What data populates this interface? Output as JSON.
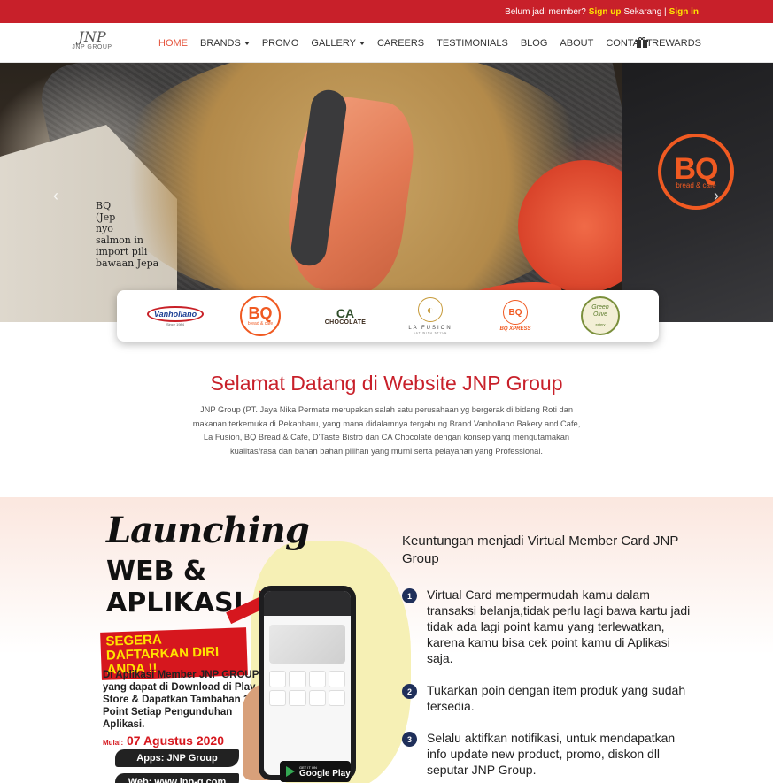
{
  "topbar": {
    "prefix": "Belum jadi member?",
    "signup": "Sign up",
    "middle": "Sekarang |",
    "signin": "Sign in"
  },
  "nav": {
    "logo_mark": "JNP",
    "logo_text": "JNP GROUP",
    "items": [
      "HOME",
      "BRANDS",
      "PROMO",
      "GALLERY",
      "CAREERS",
      "TESTIMONIALS",
      "BLOG",
      "ABOUT",
      "CONTACT"
    ],
    "rewards": "REWARDS"
  },
  "hero": {
    "newspaper_text": [
      "BQ",
      "(Jep",
      "nyo",
      "salmon in",
      "import pili",
      "bawaan Jepa"
    ],
    "bq_logo": "BQ",
    "bq_logo_sub": "bread & cafe",
    "prev_icon": "‹",
    "next_icon": "›"
  },
  "brands": {
    "vanhollano": "Vanhollano",
    "vanhollano_sub": "Since 1984",
    "bq": "BQ",
    "bq_sub": "bread & cafe",
    "ca_mark": "CA",
    "ca_text": "CHOCOLATE",
    "lafusion_mark": "◐",
    "lafusion": "LA FUSION",
    "lafusion_sub": "EAT WITH STYLE",
    "bqx_mark": "BQ",
    "bqx": "BQ XPRESS",
    "greenolive_1": "Green",
    "greenolive_2": "Olive",
    "greenolive_sub": "eatery"
  },
  "welcome": {
    "title": "Selamat Datang di Website JNP Group",
    "body": "JNP Group (PT. Jaya Nika Permata merupakan salah satu perusahaan yg bergerak di bidang Roti  dan makanan terkemuka di Pekanbaru, yang mana didalamnya tergabung Brand Vanhollano Bakery and Cafe, La Fusion, BQ Bread & Cafe, D'Taste Bistro dan CA Chocolate dengan konsep yang mengutamakan kualitas/rasa dan bahan bahan pilihan yang murni serta pelayanan yang Professional."
  },
  "poster": {
    "launching": "Launching",
    "web": "WEB &",
    "aplikasi": "APLIKASI",
    "banner": "SEGERA DAFTARKAN DIRI ANDA !!",
    "desc": "Di Aplikasi Member JNP GROUP yang dapat di Download di Play Store & Dapatkan Tambahan 10 Point Setiap Pengunduhan Aplikasi.",
    "mulai": "Mulai:",
    "date": "07 Agustus 2020",
    "apps": "Apps: JNP Group",
    "web_url": "Web: www.jnp-g.com",
    "getiton": "GET IT ON",
    "googleplay": "Google Play"
  },
  "benefits": {
    "title": "Keuntungan menjadi Virtual Member Card JNP Group",
    "items": [
      {
        "num": "1",
        "text": "Virtual Card mempermudah kamu dalam transaksi belanja,tidak perlu lagi bawa kartu jadi tidak ada lagi point kamu yang terlewatkan, karena kamu bisa cek point kamu di Aplikasi saja."
      },
      {
        "num": "2",
        "text": "Tukarkan poin dengan item produk yang sudah tersedia."
      },
      {
        "num": "3",
        "text": "Selalu aktifkan notifikasi, untuk mendapatkan info update new product, promo, diskon dll seputar JNP Group."
      }
    ]
  },
  "colors": {
    "brand_red": "#c8202a",
    "active_nav": "#e5553e",
    "highlight": "#ffe400",
    "bq_orange": "#f05a22",
    "number_badge": "#1f2f5a"
  }
}
